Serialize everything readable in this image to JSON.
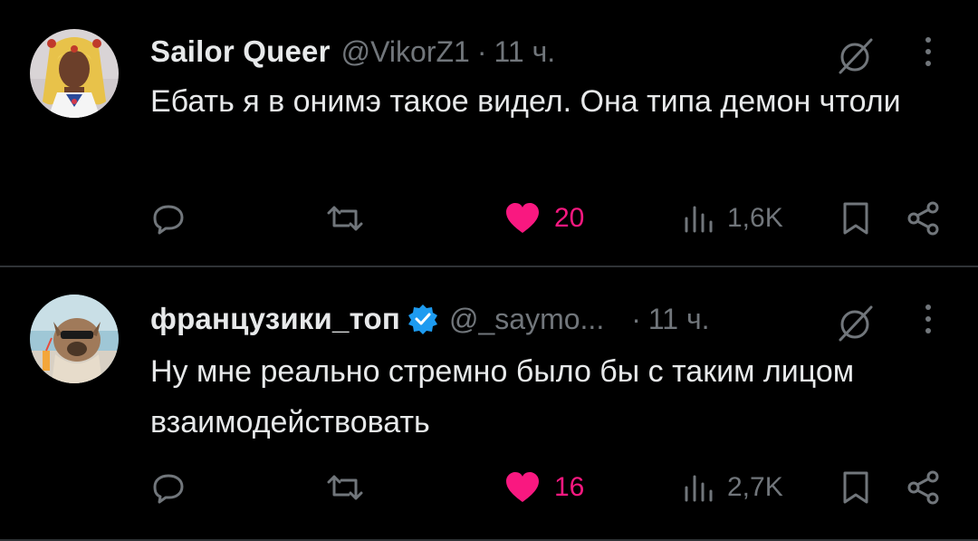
{
  "tweets": [
    {
      "display_name": "Sailor Queer",
      "handle": "@VikorZ1",
      "separator": "·",
      "time": "11 ч.",
      "verified": false,
      "text": "Ебать я в онимэ такое видел. Она типа демон чтоли",
      "likes": "20",
      "views": "1,6K",
      "liked": true
    },
    {
      "display_name": "французики_топ",
      "handle": "@_saymo...",
      "separator": "·",
      "time": "11 ч.",
      "verified": true,
      "text": "Ну мне реально стремно было бы с таким лицом взаимодействовать",
      "likes": "16",
      "views": "2,7K",
      "liked": true
    }
  ],
  "colors": {
    "background": "#000000",
    "text": "#e7e9ea",
    "muted": "#71767b",
    "like": "#f91880",
    "verified": "#1d9bf0",
    "divider": "#2f3336"
  },
  "icons": [
    "reply-icon",
    "retweet-icon",
    "heart-icon",
    "views-icon",
    "bookmark-icon",
    "share-icon",
    "grok-icon",
    "more-icon",
    "verified-badge-icon"
  ]
}
